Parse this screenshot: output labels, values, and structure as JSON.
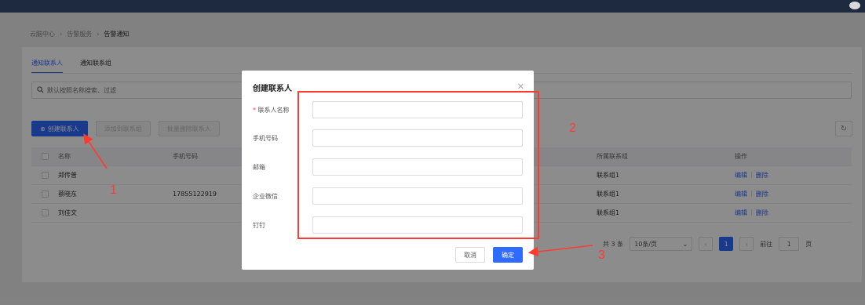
{
  "breadcrumb": {
    "items": [
      "云脑中心",
      "告警服务",
      "告警通知"
    ]
  },
  "tabs": [
    {
      "label": "通知联系人",
      "active": true
    },
    {
      "label": "通知联系组",
      "active": false
    }
  ],
  "search": {
    "placeholder": "默认按照名称搜索、过滤"
  },
  "toolbar": {
    "create_label": "创建联系人",
    "add_to_group_label": "添加到联系组",
    "batch_delete_label": "批量删除联系人"
  },
  "table": {
    "headers": {
      "name": "名称",
      "phone": "手机号码",
      "group": "所属联系组",
      "ops": "操作"
    },
    "rows": [
      {
        "name": "郑传普",
        "phone": "",
        "group": "联系组1",
        "edit": "编辑",
        "delete": "删除"
      },
      {
        "name": "蔡晓东",
        "phone": "17855122919",
        "group": "联系组1",
        "edit": "编辑",
        "delete": "删除"
      },
      {
        "name": "刘佳文",
        "phone": "",
        "group": "联系组1",
        "edit": "编辑",
        "delete": "删除"
      }
    ]
  },
  "pagination": {
    "total": "共 3 条",
    "page_size": "10条/页",
    "current_page": "1",
    "goto_label": "前往",
    "goto_value": "1",
    "page_unit": "页"
  },
  "modal": {
    "title": "创建联系人",
    "fields": [
      {
        "label": "联系人名称",
        "required": true,
        "value": ""
      },
      {
        "label": "手机号码",
        "required": false,
        "value": ""
      },
      {
        "label": "邮箱",
        "required": false,
        "value": ""
      },
      {
        "label": "企业微信",
        "required": false,
        "value": ""
      },
      {
        "label": "钉钉",
        "required": false,
        "value": ""
      }
    ],
    "cancel_label": "取消",
    "confirm_label": "确定"
  },
  "annotations": {
    "step1": "1",
    "step2": "2",
    "step3": "3"
  },
  "colors": {
    "primary": "#2f6bff",
    "annotation": "#ff3b30"
  }
}
